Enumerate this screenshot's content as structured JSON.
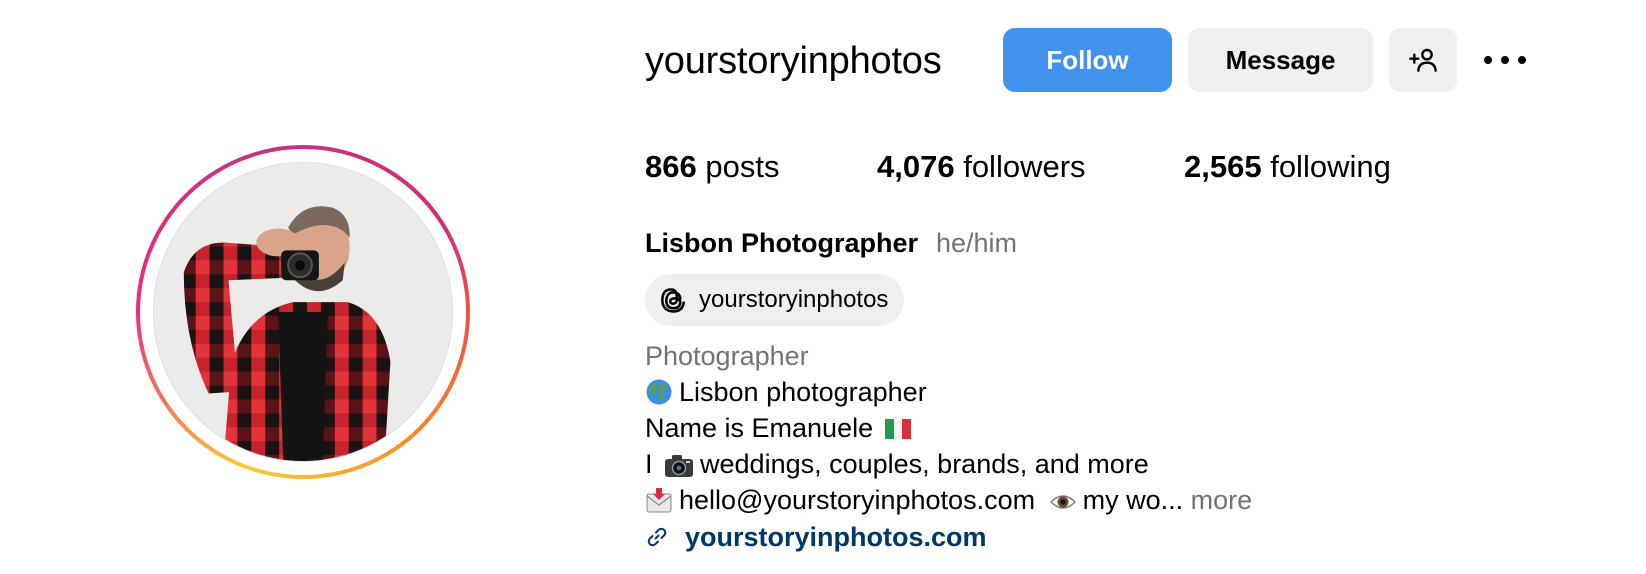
{
  "profile": {
    "username": "yourstoryinphotos",
    "follow_label": "Follow",
    "message_label": "Message",
    "suggest_icon": "person-add-icon",
    "more_icon": "ellipsis-icon"
  },
  "stats": {
    "posts_count": "866",
    "posts_label": "posts",
    "followers_count": "4,076",
    "followers_label": "followers",
    "following_count": "2,565",
    "following_label": "following"
  },
  "bio": {
    "full_name": "Lisbon Photographer",
    "pronouns": "he/him",
    "threads_handle": "yourstoryinphotos",
    "category": "Photographer",
    "line1": "Lisbon photographer",
    "line2": "Name is Emanuele",
    "line3_prefix": "I",
    "line3_suffix": "weddings, couples, brands, and more",
    "line4_email": "hello@yourstoryinphotos.com",
    "line4_rest": "my wo...",
    "more_label": "more",
    "website": "yourstoryinphotos.com"
  },
  "colors": {
    "follow_button": "#4192ef",
    "secondary_button": "#efefef",
    "muted_text": "#737373",
    "link_text": "#00376b"
  }
}
